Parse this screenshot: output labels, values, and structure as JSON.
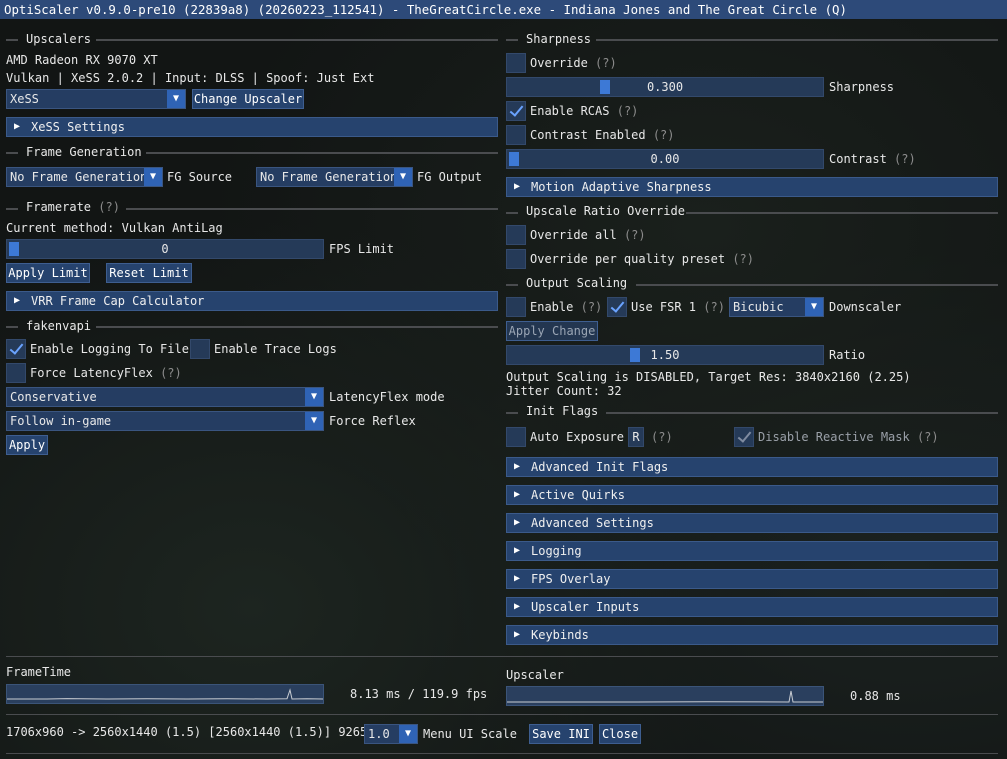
{
  "window": {
    "title": "OptiScaler v0.9.0-pre10 (22839a8) (20260223_112541) - TheGreatCircle.exe - Indiana Jones and The Great Circle (Q)"
  },
  "help_mark": "(?)",
  "upscalers": {
    "header": "Upscalers",
    "gpu": "AMD Radeon RX 9070 XT",
    "info": "Vulkan | XeSS 2.0.2 | Input: DLSS | Spoof: Just Ext",
    "selected": "XeSS",
    "change_button": "Change Upscaler",
    "settings_collapse": "XeSS Settings"
  },
  "frame_generation": {
    "header": "Frame Generation",
    "source_value": "No Frame Generation",
    "source_label": "FG Source",
    "output_value": "No Frame Generation",
    "output_label": "FG Output"
  },
  "framerate": {
    "header": "Framerate",
    "method": "Current method: Vulkan AntiLag",
    "fps_value": "0",
    "fps_fraction": 0,
    "fps_label": "FPS Limit",
    "apply_button": "Apply Limit",
    "reset_button": "Reset Limit",
    "vrr_collapse": "VRR Frame Cap Calculator"
  },
  "fakenvapi": {
    "header": "fakenvapi",
    "logging_label": "Enable Logging To File",
    "logging_checked": true,
    "trace_label": "Enable Trace Logs",
    "trace_checked": false,
    "force_lf_label": "Force LatencyFlex",
    "force_lf_checked": false,
    "lf_mode_value": "Conservative",
    "lf_mode_label": "LatencyFlex mode",
    "reflex_value": "Follow in-game",
    "reflex_label": "Force Reflex",
    "apply_button": "Apply"
  },
  "sharpness": {
    "header": "Sharpness",
    "override_label": "Override",
    "override_checked": false,
    "value": "0.300",
    "fraction": 0.3,
    "label": "Sharpness",
    "rcas_label": "Enable RCAS",
    "rcas_checked": true,
    "contrast_enabled_label": "Contrast Enabled",
    "contrast_enabled_checked": false,
    "contrast_value": "0.00",
    "contrast_fraction": 0,
    "contrast_label": "Contrast",
    "motion_collapse": "Motion Adaptive Sharpness"
  },
  "ratio_override": {
    "header": "Upscale Ratio Override",
    "all_label": "Override all",
    "per_preset_label": "Override per quality preset"
  },
  "output_scaling": {
    "header": "Output Scaling",
    "enable_label": "Enable",
    "fsr_label": "Use FSR 1",
    "fsr_checked": true,
    "downscaler_value": "Bicubic",
    "downscaler_label": "Downscaler",
    "apply_button": "Apply Change",
    "ratio_value": "1.50",
    "ratio_fraction": 0.4,
    "ratio_label": "Ratio",
    "status": "Output Scaling is DISABLED, Target Res: 3840x2160 (2.25)",
    "jitter": "Jitter Count: 32"
  },
  "init_flags": {
    "header": "Init Flags",
    "auto_exposure_label": "Auto Exposure",
    "r_badge": "R",
    "reactive_mask_label": "Disable Reactive Mask",
    "reactive_mask_checked": true
  },
  "sections": [
    "Advanced Init Flags",
    "Active Quirks",
    "Advanced Settings",
    "Logging",
    "FPS Overlay",
    "Upscaler Inputs",
    "Keybinds"
  ],
  "stats": {
    "frametime_label": "FrameTime",
    "frametime_value": "8.13 ms /  119.9 fps",
    "upscaler_label": "Upscaler",
    "upscaler_value": "0.88 ms"
  },
  "footer": {
    "resolution": "1706x960 -> 2560x1440 (1.5) [2560x1440 (1.5)] 9265",
    "scale_value": "1.0",
    "scale_label": "Menu UI Scale",
    "save_button": "Save INI",
    "close_button": "Close"
  }
}
